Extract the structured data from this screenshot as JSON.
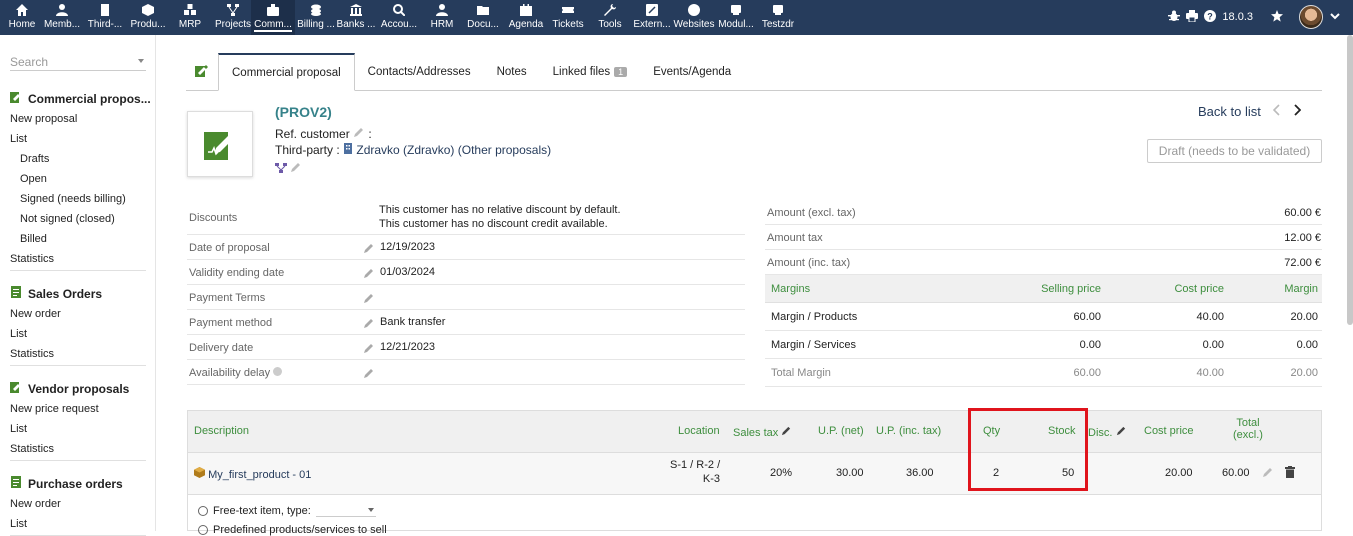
{
  "topmenu": [
    {
      "label": "Home",
      "icon": "home-icon",
      "w": 42
    },
    {
      "label": "Memb...",
      "icon": "member-icon",
      "w": 42
    },
    {
      "label": "Third-...",
      "icon": "building-icon",
      "w": 42
    },
    {
      "label": "Produ...",
      "icon": "cube-icon",
      "w": 42
    },
    {
      "label": "MRP",
      "icon": "cubes-icon",
      "w": 42
    },
    {
      "label": "Projects",
      "icon": "sitemap-icon",
      "w": 42
    },
    {
      "label": "Comm...",
      "icon": "briefcase-icon",
      "w": 42,
      "active": true
    },
    {
      "label": "Billing ...",
      "icon": "coins-icon",
      "w": 42
    },
    {
      "label": "Banks ...",
      "icon": "bank-icon",
      "w": 42
    },
    {
      "label": "Accou...",
      "icon": "magnifier-icon",
      "w": 42
    },
    {
      "label": "HRM",
      "icon": "user-tie-icon",
      "w": 42
    },
    {
      "label": "Docu...",
      "icon": "folder-icon",
      "w": 42
    },
    {
      "label": "Agenda",
      "icon": "calendar-icon",
      "w": 42
    },
    {
      "label": "Tickets",
      "icon": "ticket-icon",
      "w": 42
    },
    {
      "label": "Tools",
      "icon": "wrench-icon",
      "w": 42
    },
    {
      "label": "Extern...",
      "icon": "external-icon",
      "w": 42
    },
    {
      "label": "Websites",
      "icon": "globe-icon",
      "w": 42
    },
    {
      "label": "Modul...",
      "icon": "module-icon",
      "w": 42
    },
    {
      "label": "Testzdr",
      "icon": "module-icon",
      "w": 42
    }
  ],
  "topright": {
    "version": "18.0.3"
  },
  "sidebar": {
    "search_placeholder": "Search",
    "sections": [
      {
        "title": "Commercial propos...",
        "icon": "proposal-icon",
        "items": [
          {
            "label": "New proposal",
            "sub": false
          },
          {
            "label": "List",
            "sub": false
          },
          {
            "label": "Drafts",
            "sub": true
          },
          {
            "label": "Open",
            "sub": true
          },
          {
            "label": "Signed (needs billing)",
            "sub": true
          },
          {
            "label": "Not signed (closed)",
            "sub": true
          },
          {
            "label": "Billed",
            "sub": true
          },
          {
            "label": "Statistics",
            "sub": false
          }
        ]
      },
      {
        "title": "Sales Orders",
        "icon": "order-icon",
        "items": [
          {
            "label": "New order",
            "sub": false
          },
          {
            "label": "List",
            "sub": false
          },
          {
            "label": "Statistics",
            "sub": false
          }
        ]
      },
      {
        "title": "Vendor proposals",
        "icon": "proposal-icon",
        "items": [
          {
            "label": "New price request",
            "sub": false
          },
          {
            "label": "List",
            "sub": false
          },
          {
            "label": "Statistics",
            "sub": false
          }
        ]
      },
      {
        "title": "Purchase orders",
        "icon": "order-icon",
        "items": [
          {
            "label": "New order",
            "sub": false
          },
          {
            "label": "List",
            "sub": false
          }
        ]
      }
    ]
  },
  "tabs": [
    {
      "label": "Commercial proposal",
      "active": true
    },
    {
      "label": "Contacts/Addresses",
      "active": false
    },
    {
      "label": "Notes",
      "active": false
    },
    {
      "label": "Linked files",
      "active": false,
      "badge": "1"
    },
    {
      "label": "Events/Agenda",
      "active": false
    }
  ],
  "header": {
    "ref": "(PROV2)",
    "ref_customer": "Ref. customer",
    "ref_customer_suffix": ":",
    "thirdparty_label": "Third-party :",
    "thirdparty_name": "Zdravko (Zdravko)",
    "other_proposals": "(Other proposals)",
    "back_to_list": "Back to list",
    "status": "Draft (needs to be validated)"
  },
  "info": {
    "discounts_label": "Discounts",
    "discounts_line1": "This customer has no relative discount by default.",
    "discounts_line2": "This customer has no discount credit available.",
    "rows": [
      {
        "label": "Date of proposal",
        "value": "12/19/2023"
      },
      {
        "label": "Validity ending date",
        "value": "01/03/2024"
      },
      {
        "label": "Payment Terms",
        "value": ""
      },
      {
        "label": "Payment method",
        "value": "Bank transfer"
      },
      {
        "label": "Delivery date",
        "value": "12/21/2023"
      },
      {
        "label": "Availability delay",
        "value": ""
      }
    ]
  },
  "amounts": [
    {
      "label": "Amount (excl. tax)",
      "value": "60.00 €"
    },
    {
      "label": "Amount tax",
      "value": "12.00 €"
    },
    {
      "label": "Amount (inc. tax)",
      "value": "72.00 €"
    }
  ],
  "margins": {
    "headers": [
      "Margins",
      "Selling price",
      "Cost price",
      "Margin"
    ],
    "rows": [
      {
        "label": "Margin / Products",
        "selling": "60.00",
        "cost": "40.00",
        "margin": "20.00"
      },
      {
        "label": "Margin / Services",
        "selling": "0.00",
        "cost": "0.00",
        "margin": "0.00"
      },
      {
        "label": "Total Margin",
        "selling": "60.00",
        "cost": "40.00",
        "margin": "20.00"
      }
    ]
  },
  "lines": {
    "headers": {
      "description": "Description",
      "location": "Location",
      "sales_tax": "Sales tax",
      "up_net": "U.P. (net)",
      "up_inc": "U.P. (inc. tax)",
      "qty": "Qty",
      "stock": "Stock",
      "disc": "Disc.",
      "cost_price": "Cost price",
      "total_l1": "Total",
      "total_l2": "(excl.)"
    },
    "row": {
      "product": "My_first_product - 01",
      "location_l1": "S-1 / R-2 /",
      "location_l2": "K-3",
      "sales_tax": "20%",
      "up_net": "30.00",
      "up_inc": "36.00",
      "qty": "2",
      "stock": "50",
      "cost_price": "20.00",
      "total": "60.00"
    },
    "add_freetext": "Free-text item, type:",
    "add_predefined": "Predefined products/services to sell"
  }
}
